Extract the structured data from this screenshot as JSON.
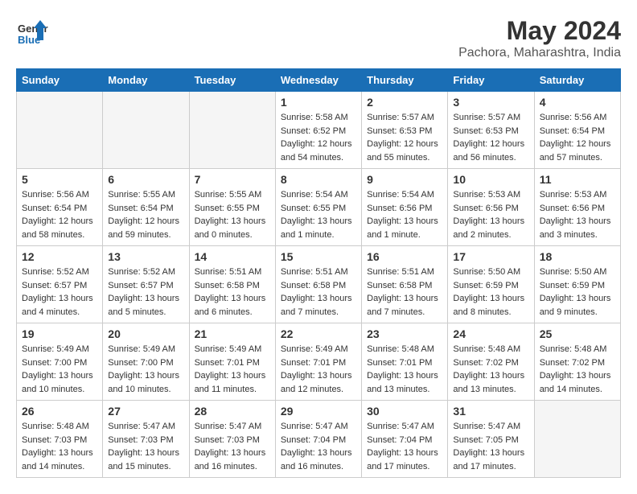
{
  "header": {
    "logo_line1": "General",
    "logo_line2": "Blue",
    "month_year": "May 2024",
    "location": "Pachora, Maharashtra, India"
  },
  "weekdays": [
    "Sunday",
    "Monday",
    "Tuesday",
    "Wednesday",
    "Thursday",
    "Friday",
    "Saturday"
  ],
  "weeks": [
    [
      {
        "day": "",
        "detail": ""
      },
      {
        "day": "",
        "detail": ""
      },
      {
        "day": "",
        "detail": ""
      },
      {
        "day": "1",
        "detail": "Sunrise: 5:58 AM\nSunset: 6:52 PM\nDaylight: 12 hours\nand 54 minutes."
      },
      {
        "day": "2",
        "detail": "Sunrise: 5:57 AM\nSunset: 6:53 PM\nDaylight: 12 hours\nand 55 minutes."
      },
      {
        "day": "3",
        "detail": "Sunrise: 5:57 AM\nSunset: 6:53 PM\nDaylight: 12 hours\nand 56 minutes."
      },
      {
        "day": "4",
        "detail": "Sunrise: 5:56 AM\nSunset: 6:54 PM\nDaylight: 12 hours\nand 57 minutes."
      }
    ],
    [
      {
        "day": "5",
        "detail": "Sunrise: 5:56 AM\nSunset: 6:54 PM\nDaylight: 12 hours\nand 58 minutes."
      },
      {
        "day": "6",
        "detail": "Sunrise: 5:55 AM\nSunset: 6:54 PM\nDaylight: 12 hours\nand 59 minutes."
      },
      {
        "day": "7",
        "detail": "Sunrise: 5:55 AM\nSunset: 6:55 PM\nDaylight: 13 hours\nand 0 minutes."
      },
      {
        "day": "8",
        "detail": "Sunrise: 5:54 AM\nSunset: 6:55 PM\nDaylight: 13 hours\nand 1 minute."
      },
      {
        "day": "9",
        "detail": "Sunrise: 5:54 AM\nSunset: 6:56 PM\nDaylight: 13 hours\nand 1 minute."
      },
      {
        "day": "10",
        "detail": "Sunrise: 5:53 AM\nSunset: 6:56 PM\nDaylight: 13 hours\nand 2 minutes."
      },
      {
        "day": "11",
        "detail": "Sunrise: 5:53 AM\nSunset: 6:56 PM\nDaylight: 13 hours\nand 3 minutes."
      }
    ],
    [
      {
        "day": "12",
        "detail": "Sunrise: 5:52 AM\nSunset: 6:57 PM\nDaylight: 13 hours\nand 4 minutes."
      },
      {
        "day": "13",
        "detail": "Sunrise: 5:52 AM\nSunset: 6:57 PM\nDaylight: 13 hours\nand 5 minutes."
      },
      {
        "day": "14",
        "detail": "Sunrise: 5:51 AM\nSunset: 6:58 PM\nDaylight: 13 hours\nand 6 minutes."
      },
      {
        "day": "15",
        "detail": "Sunrise: 5:51 AM\nSunset: 6:58 PM\nDaylight: 13 hours\nand 7 minutes."
      },
      {
        "day": "16",
        "detail": "Sunrise: 5:51 AM\nSunset: 6:58 PM\nDaylight: 13 hours\nand 7 minutes."
      },
      {
        "day": "17",
        "detail": "Sunrise: 5:50 AM\nSunset: 6:59 PM\nDaylight: 13 hours\nand 8 minutes."
      },
      {
        "day": "18",
        "detail": "Sunrise: 5:50 AM\nSunset: 6:59 PM\nDaylight: 13 hours\nand 9 minutes."
      }
    ],
    [
      {
        "day": "19",
        "detail": "Sunrise: 5:49 AM\nSunset: 7:00 PM\nDaylight: 13 hours\nand 10 minutes."
      },
      {
        "day": "20",
        "detail": "Sunrise: 5:49 AM\nSunset: 7:00 PM\nDaylight: 13 hours\nand 10 minutes."
      },
      {
        "day": "21",
        "detail": "Sunrise: 5:49 AM\nSunset: 7:01 PM\nDaylight: 13 hours\nand 11 minutes."
      },
      {
        "day": "22",
        "detail": "Sunrise: 5:49 AM\nSunset: 7:01 PM\nDaylight: 13 hours\nand 12 minutes."
      },
      {
        "day": "23",
        "detail": "Sunrise: 5:48 AM\nSunset: 7:01 PM\nDaylight: 13 hours\nand 13 minutes."
      },
      {
        "day": "24",
        "detail": "Sunrise: 5:48 AM\nSunset: 7:02 PM\nDaylight: 13 hours\nand 13 minutes."
      },
      {
        "day": "25",
        "detail": "Sunrise: 5:48 AM\nSunset: 7:02 PM\nDaylight: 13 hours\nand 14 minutes."
      }
    ],
    [
      {
        "day": "26",
        "detail": "Sunrise: 5:48 AM\nSunset: 7:03 PM\nDaylight: 13 hours\nand 14 minutes."
      },
      {
        "day": "27",
        "detail": "Sunrise: 5:47 AM\nSunset: 7:03 PM\nDaylight: 13 hours\nand 15 minutes."
      },
      {
        "day": "28",
        "detail": "Sunrise: 5:47 AM\nSunset: 7:03 PM\nDaylight: 13 hours\nand 16 minutes."
      },
      {
        "day": "29",
        "detail": "Sunrise: 5:47 AM\nSunset: 7:04 PM\nDaylight: 13 hours\nand 16 minutes."
      },
      {
        "day": "30",
        "detail": "Sunrise: 5:47 AM\nSunset: 7:04 PM\nDaylight: 13 hours\nand 17 minutes."
      },
      {
        "day": "31",
        "detail": "Sunrise: 5:47 AM\nSunset: 7:05 PM\nDaylight: 13 hours\nand 17 minutes."
      },
      {
        "day": "",
        "detail": ""
      }
    ]
  ]
}
